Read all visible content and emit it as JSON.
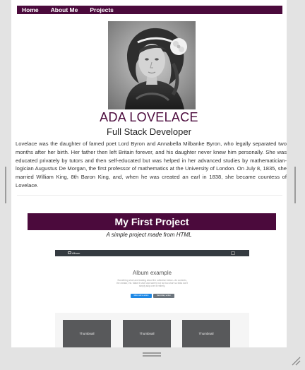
{
  "navbar": {
    "links": [
      "Home",
      "About Me",
      "Projects"
    ]
  },
  "profile": {
    "name": "ADA LOVELACE",
    "role": "Full Stack Developer",
    "bio": "Lovelace was the daughter of famed poet Lord Byron and Annabella Milbanke Byron, who legally separated two months after her birth. Her father then left Britain forever, and his daughter never knew him personally. She was educated privately by tutors and then self-educated but was helped in her advanced studies by mathematician-logician Augustus De Morgan, the first professor of mathematics at the University of London. On July 8, 1835, she married William King, 8th Baron King, and, when he was created an earl in 1838, she became countess of Lovelace."
  },
  "project": {
    "title": "My First Project",
    "subtitle": "A simple project made from HTML",
    "preview": {
      "brand": "Album",
      "heading": "Album example",
      "lead": "Something short and leading about the collection below—its contents, the creator, etc. Make it short and sweet, but not too short so folks don't simply skip over it entirely.",
      "primary_button": "Main call to action",
      "secondary_button": "Secondary action",
      "cards": [
        "Thumbnail",
        "Thumbnail",
        "Thumbnail"
      ]
    }
  },
  "colors": {
    "accent": "#4b0a3c",
    "frame": "#e3e3e3",
    "preview_nav": "#343a40",
    "preview_primary": "#1e88e5",
    "preview_secondary": "#6c757d",
    "preview_card": "#58595b"
  },
  "icons": {
    "left_resize": "resize-grip-vertical-icon",
    "right_resize": "resize-grip-vertical-icon",
    "bottom_resize": "resize-grip-horizontal-icon",
    "corner_resize": "resize-corner-icon",
    "portrait": "portrait-image"
  }
}
